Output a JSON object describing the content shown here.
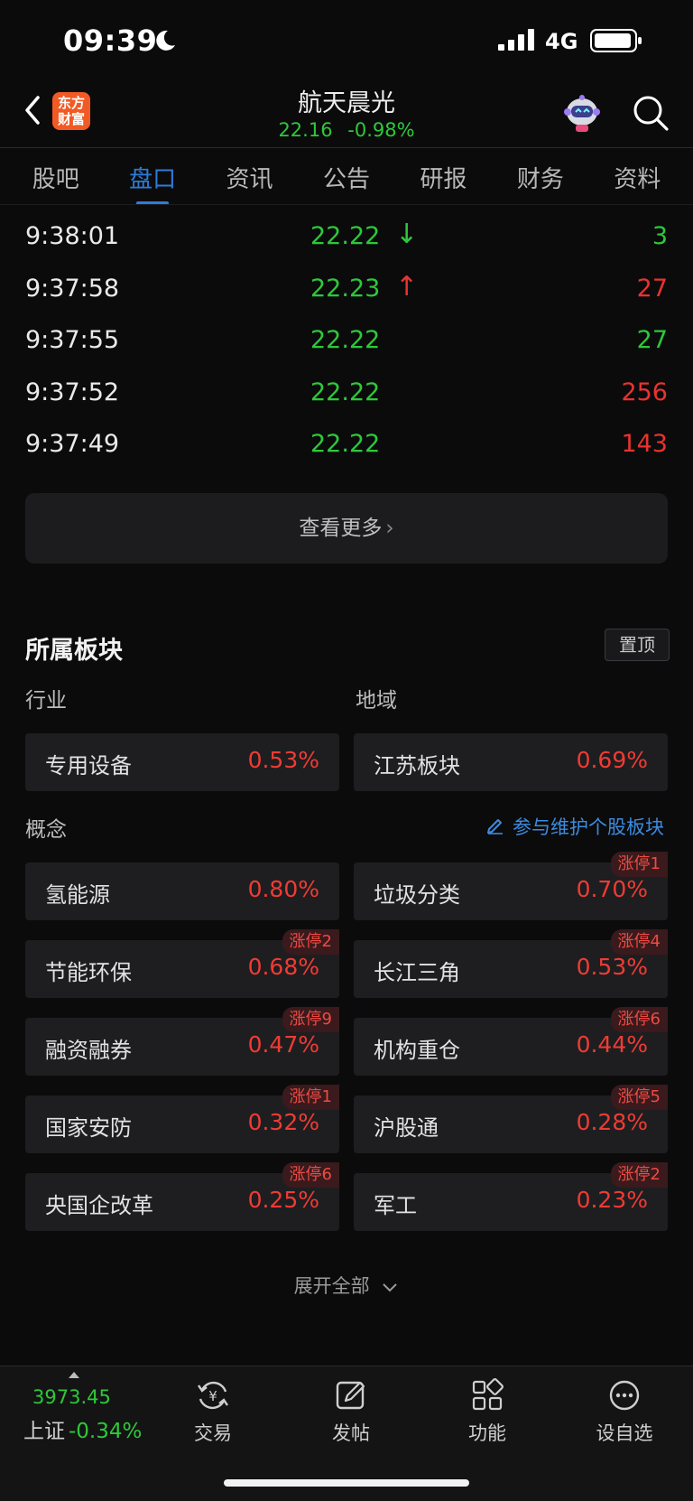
{
  "status_bar": {
    "time": "09:39",
    "network": "4G"
  },
  "header": {
    "logo_line1": "东方",
    "logo_line2": "财富",
    "stock_name": "航天晨光",
    "price": "22.16",
    "change_pct": "-0.98%"
  },
  "tabs": [
    "股吧",
    "盘口",
    "资讯",
    "公告",
    "研报",
    "财务",
    "资料"
  ],
  "active_tab": "盘口",
  "ticks": [
    {
      "time": "9:38:01",
      "price": "22.22",
      "arrow": "↓",
      "direction": "down",
      "volume": "3",
      "vol_color": "green"
    },
    {
      "time": "9:37:58",
      "price": "22.23",
      "arrow": "↑",
      "direction": "up",
      "volume": "27",
      "vol_color": "red"
    },
    {
      "time": "9:37:55",
      "price": "22.22",
      "arrow": "",
      "direction": "",
      "volume": "27",
      "vol_color": "green"
    },
    {
      "time": "9:37:52",
      "price": "22.22",
      "arrow": "",
      "direction": "",
      "volume": "256",
      "vol_color": "red"
    },
    {
      "time": "9:37:49",
      "price": "22.22",
      "arrow": "",
      "direction": "",
      "volume": "143",
      "vol_color": "red"
    }
  ],
  "more_button": "查看更多",
  "sectors": {
    "title": "所属板块",
    "pin_label": "置顶",
    "industry_label": "行业",
    "region_label": "地域",
    "concept_label": "概念",
    "maintain_link": "参与维护个股板块",
    "industry": {
      "name": "专用设备",
      "pct": "0.53%"
    },
    "region": {
      "name": "江苏板块",
      "pct": "0.69%"
    },
    "concepts": [
      {
        "name": "氢能源",
        "pct": "0.80%",
        "badge": ""
      },
      {
        "name": "垃圾分类",
        "pct": "0.70%",
        "badge": "涨停1"
      },
      {
        "name": "节能环保",
        "pct": "0.68%",
        "badge": "涨停2"
      },
      {
        "name": "长江三角",
        "pct": "0.53%",
        "badge": "涨停4"
      },
      {
        "name": "融资融券",
        "pct": "0.47%",
        "badge": "涨停9"
      },
      {
        "name": "机构重仓",
        "pct": "0.44%",
        "badge": "涨停6"
      },
      {
        "name": "国家安防",
        "pct": "0.32%",
        "badge": "涨停1"
      },
      {
        "name": "沪股通",
        "pct": "0.28%",
        "badge": "涨停5"
      },
      {
        "name": "央国企改革",
        "pct": "0.25%",
        "badge": "涨停6"
      },
      {
        "name": "军工",
        "pct": "0.23%",
        "badge": "涨停2"
      }
    ],
    "expand_all": "展开全部"
  },
  "bottom_nav": {
    "index_value": "3973.45",
    "index_name": "上证",
    "index_change": "-0.34%",
    "items": [
      {
        "label": "交易",
        "icon": "trade-icon"
      },
      {
        "label": "发帖",
        "icon": "post-icon"
      },
      {
        "label": "功能",
        "icon": "apps-icon"
      },
      {
        "label": "设自选",
        "icon": "more-icon"
      }
    ]
  },
  "colors": {
    "up": "#f03b34",
    "down": "#2ec83a",
    "accent": "#2d7cd8",
    "background": "#0b0b0c"
  }
}
